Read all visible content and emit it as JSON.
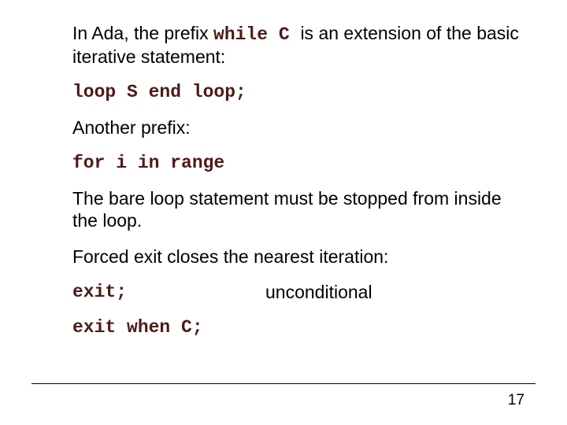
{
  "p1a": "In Ada, the prefix ",
  "p1code": "while C ",
  "p1b": "is an extension of the basic iterative statement:",
  "code1": "loop S end loop;",
  "p2": "Another prefix:",
  "code2": "for i in range",
  "p3": "The bare loop statement must be stopped from inside the loop.",
  "p4": "Forced exit closes the nearest iteration:",
  "code3": "exit;",
  "label3": "unconditional",
  "code4": "exit when C;",
  "page": "17"
}
